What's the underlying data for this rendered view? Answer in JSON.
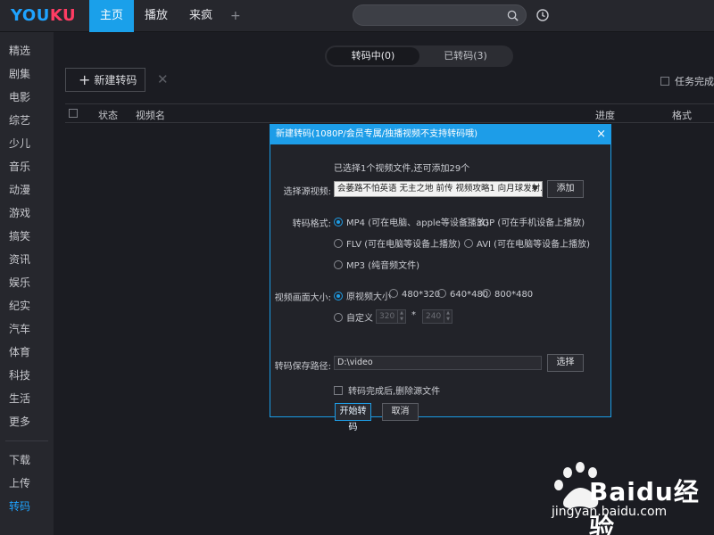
{
  "app": {
    "logo_part1": "YOU",
    "logo_part2": "KU",
    "brand_blue": "#1fa3ff",
    "brand_red": "#ff3c63",
    "accent": "#1d9de8"
  },
  "nav": {
    "tabs": [
      {
        "label": "主页",
        "active": true
      },
      {
        "label": "播放",
        "active": false
      },
      {
        "label": "来疯",
        "active": false
      }
    ],
    "add_label": "+"
  },
  "sidebar": {
    "items": [
      {
        "label": "精选"
      },
      {
        "label": "剧集"
      },
      {
        "label": "电影"
      },
      {
        "label": "综艺"
      },
      {
        "label": "少儿"
      },
      {
        "label": "音乐"
      },
      {
        "label": "动漫"
      },
      {
        "label": "游戏"
      },
      {
        "label": "搞笑"
      },
      {
        "label": "资讯"
      },
      {
        "label": "娱乐"
      },
      {
        "label": "纪实"
      },
      {
        "label": "汽车"
      },
      {
        "label": "体育"
      },
      {
        "label": "科技"
      },
      {
        "label": "生活"
      },
      {
        "label": "更多"
      }
    ],
    "bottom": [
      {
        "label": "下载"
      },
      {
        "label": "上传"
      },
      {
        "label": "转码",
        "active": true
      }
    ]
  },
  "main": {
    "segments": {
      "active": "转码中(0)",
      "inactive": "已转码(3)"
    },
    "new_button": "新建转码",
    "delete_icon": "close-icon",
    "done_option": "任务完成后",
    "columns": {
      "status": "状态",
      "name": "视频名",
      "progress": "进度",
      "format": "格式"
    }
  },
  "dialog": {
    "title": "新建转码(1080P/会员专属/独播视频不支持转码哦)",
    "close": "×",
    "info": "已选择1个视频文件,还可添加29个",
    "source_label": "选择源视频:",
    "source_value": "会萎路不怕英语 无主之地 前传 视频攻略1 向月球发射...",
    "add_button": "添加",
    "format_label": "转码格式:",
    "formats": [
      {
        "label": "MP4 (可在电脑、apple等设备播放)",
        "selected": true
      },
      {
        "label": "3GP (可在手机设备上播放)",
        "selected": false
      },
      {
        "label": "FLV (可在电脑等设备上播放)",
        "selected": false
      },
      {
        "label": "AVI (可在电脑等设备上播放)",
        "selected": false
      },
      {
        "label": "MP3 (纯音频文件)",
        "selected": false
      }
    ],
    "size_label": "视频画面大小:",
    "sizes": [
      {
        "label": "原视频大小",
        "selected": true
      },
      {
        "label": "480*320",
        "selected": false
      },
      {
        "label": "640*480",
        "selected": false
      },
      {
        "label": "800*480",
        "selected": false
      }
    ],
    "custom_label": "自定义",
    "custom_width": "320",
    "custom_times": "*",
    "custom_height": "240",
    "path_label": "转码保存路径:",
    "path_value": "D:\\video",
    "browse_button": "选择",
    "delete_source_label": "转码完成后,删除源文件",
    "start_button": "开始转码",
    "cancel_button": "取消"
  },
  "watermark": {
    "brand": "Bai",
    "brand2": "du",
    "suffix": "经验",
    "url": "jingyan.baidu.com"
  }
}
